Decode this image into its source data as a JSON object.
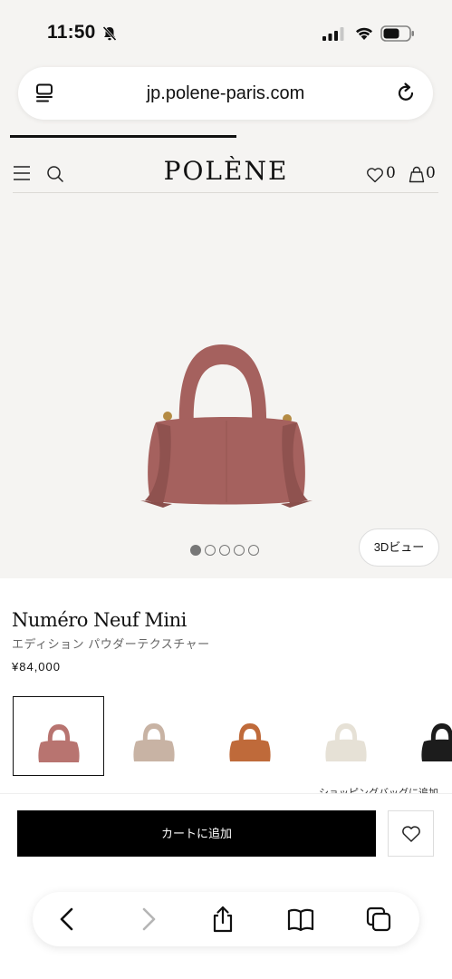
{
  "status_bar": {
    "time": "11:50",
    "icons": [
      "bell-slash-icon",
      "cellular-signal-icon",
      "wifi-icon",
      "battery-icon"
    ]
  },
  "browser": {
    "url": "jp.polene-paris.com",
    "icons": [
      "reader-mode-icon",
      "reload-icon"
    ]
  },
  "site_header": {
    "logo": "POLÈNE",
    "wishlist_count": "0",
    "cart_count": "0",
    "icons": [
      "menu-icon",
      "search-icon",
      "heart-icon",
      "bag-icon"
    ]
  },
  "gallery": {
    "slide_count": 5,
    "active_slide": 1,
    "view3d_label": "3Dビュー",
    "background": "#f5f4f2"
  },
  "product": {
    "name": "Numéro Neuf Mini",
    "edition": "エディション パウダーテクスチャー",
    "price": "¥84,000",
    "swatches": [
      {
        "color": "#b87470",
        "selected": true
      },
      {
        "color": "#c8b3a4",
        "selected": false
      },
      {
        "color": "#bf6a3a",
        "selected": false
      },
      {
        "color": "#e6e1d6",
        "selected": false
      },
      {
        "color": "#1c1c1c",
        "selected": false
      }
    ],
    "partial_caption": "ショッピングバッグに追加"
  },
  "cart_bar": {
    "add_to_cart_label": "カートに追加",
    "wishlist_icon": "heart-icon"
  },
  "safari_toolbar": {
    "icons": [
      "back-icon",
      "forward-icon",
      "share-icon",
      "bookmarks-icon",
      "tabs-icon"
    ]
  },
  "colors": {
    "page_bg": "#f5f4f2",
    "accent": "#000000",
    "bag": "#a5615e"
  }
}
